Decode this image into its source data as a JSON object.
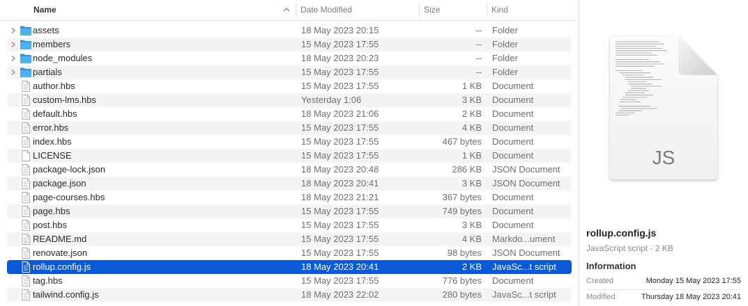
{
  "columns": {
    "name": "Name",
    "date_modified": "Date Modified",
    "size": "Size",
    "kind": "Kind"
  },
  "files": [
    {
      "name": "assets",
      "date": "18 May 2023 20:15",
      "size": "--",
      "kind": "Folder",
      "icon": "folder-icon",
      "expandable": true
    },
    {
      "name": "members",
      "date": "15 May 2023 17:55",
      "size": "--",
      "kind": "Folder",
      "icon": "folder-icon",
      "expandable": true
    },
    {
      "name": "node_modules",
      "date": "18 May 2023 20:23",
      "size": "--",
      "kind": "Folder",
      "icon": "folder-icon",
      "expandable": true
    },
    {
      "name": "partials",
      "date": "15 May 2023 17:55",
      "size": "--",
      "kind": "Folder",
      "icon": "folder-icon",
      "expandable": true
    },
    {
      "name": "author.hbs",
      "date": "15 May 2023 17:55",
      "size": "1 KB",
      "kind": "Document",
      "icon": "document-icon"
    },
    {
      "name": "custom-lms.hbs",
      "date": "Yesterday 1:06",
      "size": "3 KB",
      "kind": "Document",
      "icon": "document-icon"
    },
    {
      "name": "default.hbs",
      "date": "18 May 2023 21:06",
      "size": "2 KB",
      "kind": "Document",
      "icon": "document-icon"
    },
    {
      "name": "error.hbs",
      "date": "15 May 2023 17:55",
      "size": "4 KB",
      "kind": "Document",
      "icon": "document-icon"
    },
    {
      "name": "index.hbs",
      "date": "15 May 2023 17:55",
      "size": "467 bytes",
      "kind": "Document",
      "icon": "document-icon"
    },
    {
      "name": "LICENSE",
      "date": "15 May 2023 17:55",
      "size": "1 KB",
      "kind": "Document",
      "icon": "blank-document-icon"
    },
    {
      "name": "package-lock.json",
      "date": "18 May 2023 20:48",
      "size": "286 KB",
      "kind": "JSON Document",
      "icon": "document-icon"
    },
    {
      "name": "package.json",
      "date": "18 May 2023 20:41",
      "size": "3 KB",
      "kind": "JSON Document",
      "icon": "document-icon"
    },
    {
      "name": "page-courses.hbs",
      "date": "18 May 2023 21:21",
      "size": "367 bytes",
      "kind": "Document",
      "icon": "document-icon"
    },
    {
      "name": "page.hbs",
      "date": "15 May 2023 17:55",
      "size": "749 bytes",
      "kind": "Document",
      "icon": "document-icon"
    },
    {
      "name": "post.hbs",
      "date": "15 May 2023 17:55",
      "size": "3 KB",
      "kind": "Document",
      "icon": "document-icon"
    },
    {
      "name": "README.md",
      "date": "15 May 2023 17:55",
      "size": "4 KB",
      "kind": "Markdo...ument",
      "icon": "markdown-document-icon"
    },
    {
      "name": "renovate.json",
      "date": "15 May 2023 17:55",
      "size": "98 bytes",
      "kind": "JSON Document",
      "icon": "document-icon"
    },
    {
      "name": "rollup.config.js",
      "date": "18 May 2023 20:41",
      "size": "2 KB",
      "kind": "JavaSc...t script",
      "icon": "document-icon",
      "selected": true
    },
    {
      "name": "tag.hbs",
      "date": "15 May 2023 17:55",
      "size": "776 bytes",
      "kind": "Document",
      "icon": "document-icon"
    },
    {
      "name": "tailwind.config.js",
      "date": "18 May 2023 22:02",
      "size": "280 bytes",
      "kind": "JavaSc...t script",
      "icon": "document-icon"
    }
  ],
  "preview": {
    "icon_label": "JS",
    "file_name": "rollup.config.js",
    "file_kind": "JavaScript script - 2 KB",
    "info_title": "Information",
    "info": [
      {
        "label": "Created",
        "value": "Monday 15 May 2023 17:55"
      },
      {
        "label": "Modified",
        "value": "Thursday 18 May 2023 20:41"
      }
    ]
  },
  "colors": {
    "selection": "#0a5ad8",
    "folder": "#3aa5e8",
    "alt_row": "#f4f4f4"
  }
}
